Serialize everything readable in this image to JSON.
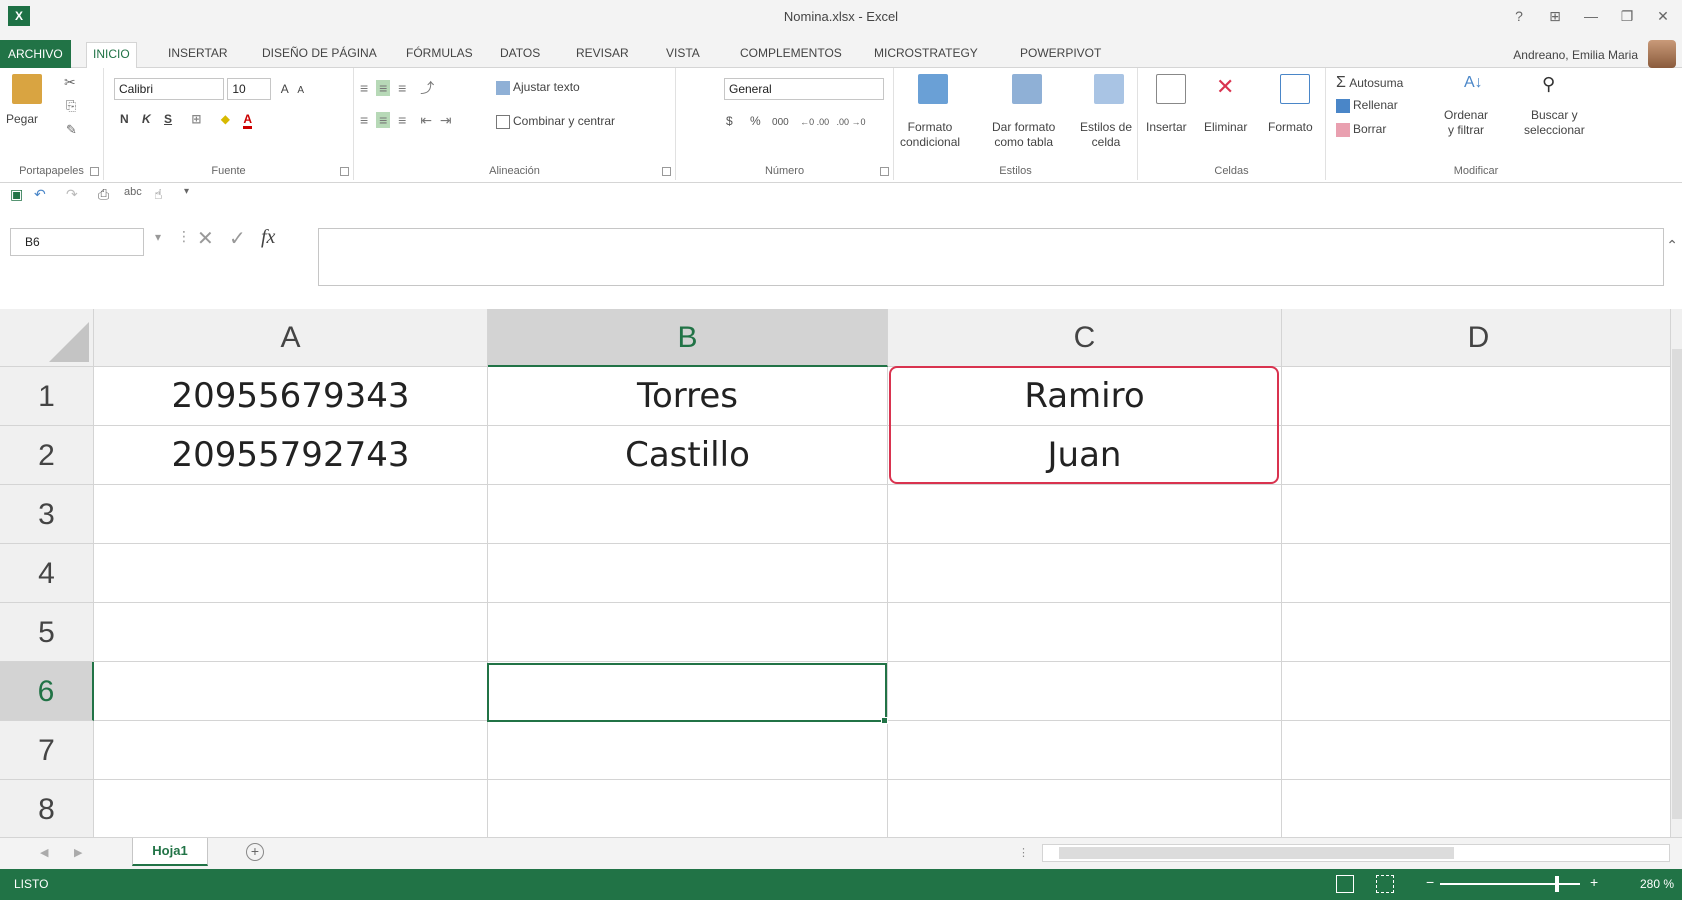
{
  "window": {
    "title": "Nomina.xlsx - Excel",
    "controls": [
      "?",
      "⊞",
      "—",
      "❐",
      "✕"
    ]
  },
  "tabs": [
    {
      "label": "ARCHIVO"
    },
    {
      "label": "INICIO"
    },
    {
      "label": "INSERTAR"
    },
    {
      "label": "DISEÑO DE PÁGINA"
    },
    {
      "label": "FÓRMULAS"
    },
    {
      "label": "DATOS"
    },
    {
      "label": "REVISAR"
    },
    {
      "label": "VISTA"
    },
    {
      "label": "COMPLEMENTOS"
    },
    {
      "label": "MICROSTRATEGY"
    },
    {
      "label": "POWERPIVOT"
    }
  ],
  "user": {
    "name": "Andreano, Emilia Maria"
  },
  "ribbon": {
    "clipboard": {
      "paste": "Pegar",
      "label": "Portapapeles"
    },
    "font": {
      "name": "Calibri",
      "size": "10",
      "bold": "N",
      "italic": "K",
      "underline": "S",
      "grow": "A",
      "shrink": "A",
      "font_color": "A",
      "label": "Fuente"
    },
    "alignment": {
      "wrap": "Ajustar texto",
      "merge": "Combinar y centrar",
      "label": "Alineación"
    },
    "number": {
      "format": "General",
      "currency": "$",
      "percent": "%",
      "thousands": "000",
      "dec_inc": "←0 .00",
      "dec_dec": ".00 →0",
      "label": "Número"
    },
    "styles": {
      "conditional": "Formato\ncondicional",
      "as_table": "Dar formato\ncomo tabla",
      "cell_styles": "Estilos de\ncelda",
      "label": "Estilos"
    },
    "cells": {
      "insert": "Insertar",
      "delete": "Eliminar",
      "format": "Formato",
      "label": "Celdas"
    },
    "editing": {
      "autosum": "Autosuma",
      "fill": "Rellenar",
      "clear": "Borrar",
      "sort": "Ordenar\ny filtrar",
      "find": "Buscar y\nseleccionar",
      "label": "Modificar"
    }
  },
  "formula_bar": {
    "name_box": "B6",
    "fx": "fx",
    "value": ""
  },
  "grid": {
    "columns": [
      "A",
      "B",
      "C",
      "D"
    ],
    "rows": [
      "1",
      "2",
      "3",
      "4",
      "5",
      "6",
      "7",
      "8"
    ],
    "selected_row": "6",
    "selected_col": "B",
    "cells": [
      [
        "20955679343",
        "Torres",
        "Ramiro",
        ""
      ],
      [
        "20955792743",
        "Castillo",
        "Juan",
        ""
      ]
    ]
  },
  "sheets": {
    "active": "Hoja1",
    "add": "+"
  },
  "status": {
    "text": "LISTO",
    "zoom": "280 %"
  },
  "colors": {
    "accent": "#217346",
    "highlight": "#d9334f"
  }
}
